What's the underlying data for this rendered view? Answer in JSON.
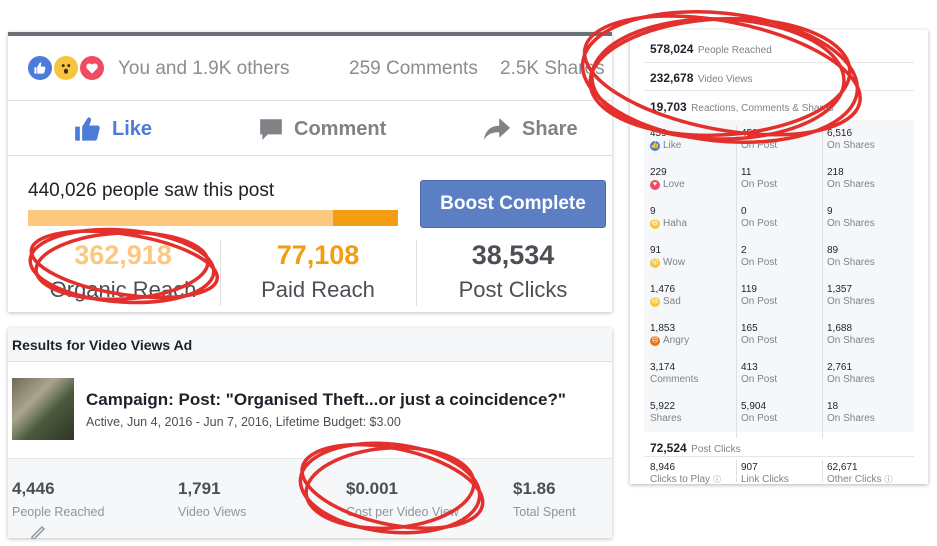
{
  "post": {
    "reactions_summary": "You and 1.9K others",
    "comments": "259 Comments",
    "shares": "2.5K Shares",
    "actions": {
      "like": "Like",
      "comment": "Comment",
      "share": "Share"
    },
    "reach_line": "440,026 people saw this post",
    "organic_fraction": 0.825,
    "boost_label": "Boost Complete",
    "stats": [
      {
        "value": "362,918",
        "label": "Organic Reach",
        "color": "#fbc87e"
      },
      {
        "value": "77,108",
        "label": "Paid Reach",
        "color": "#f29d12"
      },
      {
        "value": "38,534",
        "label": "Post Clicks",
        "color": "#4b4f56"
      }
    ]
  },
  "ad": {
    "header": "Results for Video Views Ad",
    "campaign_title": "Campaign: Post: \"Organised Theft...or just a coincidence?\"",
    "campaign_sub": "Active, Jun 4, 2016 - Jun 7, 2016, Lifetime Budget: $3.00",
    "stats": [
      {
        "value": "4,446",
        "label": "People Reached"
      },
      {
        "value": "1,791",
        "label": "Video Views"
      },
      {
        "value": "$0.001",
        "label": "Cost per Video View"
      },
      {
        "value": "$1.86",
        "label": "Total Spent"
      }
    ]
  },
  "insights": {
    "people_reached": {
      "value": "578,024",
      "label": "People Reached"
    },
    "video_views": {
      "value": "232,678",
      "label": "Video Views"
    },
    "engagement": {
      "value": "19,703",
      "label": "Reactions, Comments & Shares"
    },
    "reaction_rows": [
      {
        "total": "459",
        "name": "Like",
        "icon": "like-icon",
        "on_post": "450",
        "on_shares": "6,516"
      },
      {
        "total": "229",
        "name": "Love",
        "icon": "love-icon",
        "on_post": "11",
        "on_shares": "218"
      },
      {
        "total": "9",
        "name": "Haha",
        "icon": "haha-icon",
        "on_post": "0",
        "on_shares": "9"
      },
      {
        "total": "91",
        "name": "Wow",
        "icon": "wow-icon",
        "on_post": "2",
        "on_shares": "89"
      },
      {
        "total": "1,476",
        "name": "Sad",
        "icon": "sad-icon",
        "on_post": "119",
        "on_shares": "1,357"
      },
      {
        "total": "1,853",
        "name": "Angry",
        "icon": "angry-icon",
        "on_post": "165",
        "on_shares": "1,688"
      },
      {
        "total": "3,174",
        "name": "Comments",
        "icon": "",
        "on_post": "413",
        "on_shares": "2,761"
      },
      {
        "total": "5,922",
        "name": "Shares",
        "icon": "",
        "on_post": "5,904",
        "on_shares": "18"
      }
    ],
    "on_post_label": "On Post",
    "on_shares_label": "On Shares",
    "post_clicks": {
      "value": "72,524",
      "label": "Post Clicks"
    },
    "click_rows": [
      {
        "value": "8,946",
        "label": "Clicks to Play"
      },
      {
        "value": "907",
        "label": "Link Clicks"
      },
      {
        "value": "62,671",
        "label": "Other Clicks"
      }
    ]
  },
  "colors": {
    "facebook_blue": "#4c7bd9",
    "organic": "#fbc87e",
    "paid": "#f29d12",
    "annotation_red": "#e3302c"
  }
}
